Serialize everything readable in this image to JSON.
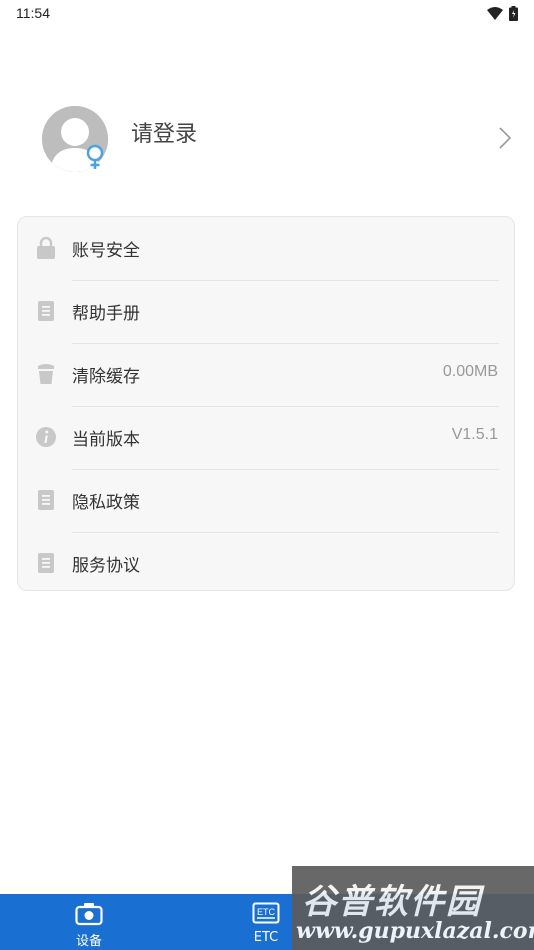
{
  "status_bar": {
    "time": "11:54"
  },
  "profile": {
    "login_label": "请登录"
  },
  "menu": {
    "items": [
      {
        "label": "账号安全",
        "icon": "lock-icon",
        "value": ""
      },
      {
        "label": "帮助手册",
        "icon": "document-icon",
        "value": ""
      },
      {
        "label": "清除缓存",
        "icon": "trash-icon",
        "value": "0.00MB"
      },
      {
        "label": "当前版本",
        "icon": "info-icon",
        "value": "V1.5.1"
      },
      {
        "label": "隐私政策",
        "icon": "document-icon",
        "value": ""
      },
      {
        "label": "服务协议",
        "icon": "document-icon",
        "value": ""
      }
    ]
  },
  "tab_bar": {
    "tabs": [
      {
        "label": "设备",
        "icon": "camera-icon"
      },
      {
        "label": "ETC",
        "icon": "etc-icon",
        "icon_text": "ETC"
      }
    ]
  },
  "watermark": {
    "title": "谷普软件园",
    "url": "www.gupuxlazal.com"
  },
  "colors": {
    "tab_bar": "#1a6fd3",
    "gender_icon": "#4aa3df",
    "icon_gray": "#c8c8c8"
  }
}
